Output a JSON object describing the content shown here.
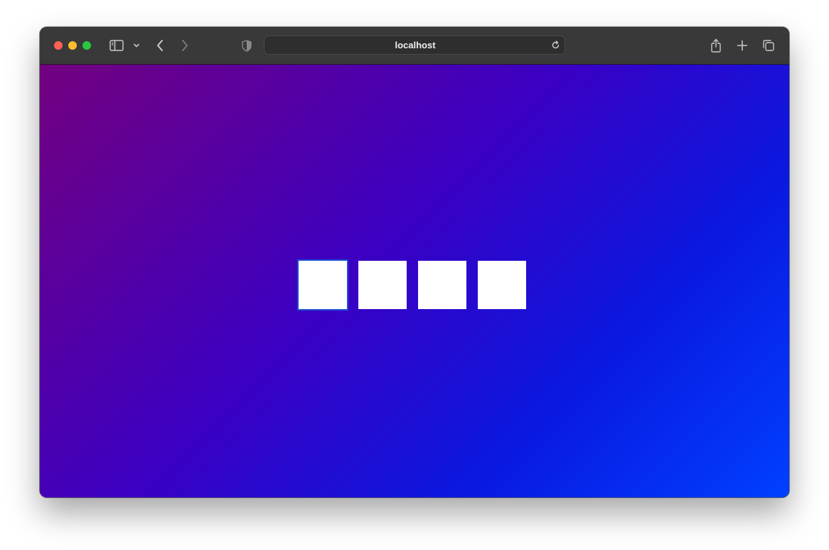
{
  "browser": {
    "url": "localhost",
    "icons": {
      "sidebar": "sidebar-icon",
      "sidebar_menu": "chevron-down-icon",
      "back": "back-arrow-icon",
      "forward": "forward-arrow-icon",
      "privacy": "shield-icon",
      "reload": "reload-icon",
      "share": "share-icon",
      "new_tab": "plus-icon",
      "tab_overview": "tabs-icon"
    }
  },
  "page": {
    "background_colors": [
      "#73007f",
      "#3a00c4",
      "#0a18e0",
      "#0040ff"
    ],
    "code_inputs": [
      {
        "value": "",
        "focused": true
      },
      {
        "value": "",
        "focused": false
      },
      {
        "value": "",
        "focused": false
      },
      {
        "value": "",
        "focused": false
      }
    ]
  }
}
